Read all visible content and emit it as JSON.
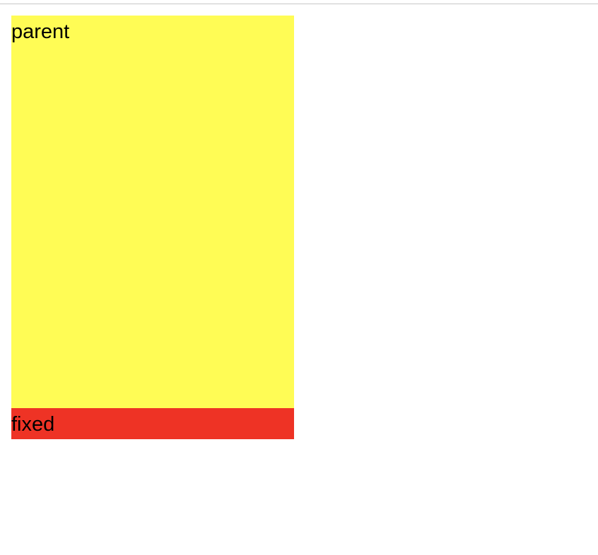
{
  "colors": {
    "parent_background": "#fffc55",
    "fixed_background": "#ee3325",
    "text": "#000000",
    "divider": "#c8c8c8"
  },
  "parent": {
    "label": "parent"
  },
  "fixed": {
    "label": "fixed"
  }
}
